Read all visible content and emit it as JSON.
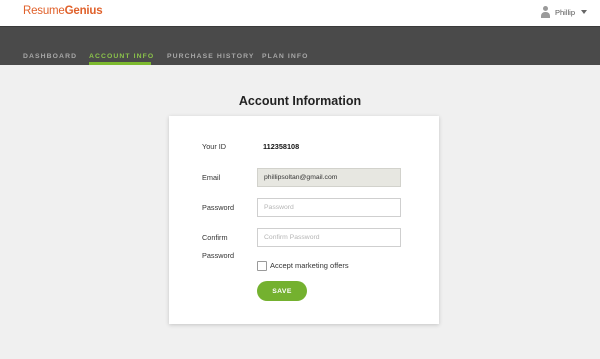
{
  "brand": {
    "part1": "Resume",
    "part2": "Genius"
  },
  "user": {
    "name": "Phillip",
    "icon": "user-icon"
  },
  "nav": {
    "items": [
      {
        "label": "DASHBOARD",
        "active": false
      },
      {
        "label": "ACCOUNT INFO",
        "active": true
      },
      {
        "label": "PURCHASE HISTORY",
        "active": false
      },
      {
        "label": "PLAN INFO",
        "active": false
      }
    ]
  },
  "page": {
    "title": "Account Information"
  },
  "form": {
    "id_label": "Your ID",
    "id_value": "112358108",
    "email_label": "Email",
    "email_value": "phillipsoltan@gmail.com",
    "password_label": "Password",
    "password_placeholder": "Password",
    "confirm_label_line1": "Confirm",
    "confirm_label_line2": "Password",
    "confirm_placeholder": "Confirm Password",
    "marketing_label": "Accept marketing offers",
    "marketing_checked": false,
    "save_label": "SAVE"
  },
  "colors": {
    "brand": "#e0612b",
    "accent": "#74b12f",
    "navbar": "#4a4a4a",
    "background": "#f0f0f0"
  }
}
